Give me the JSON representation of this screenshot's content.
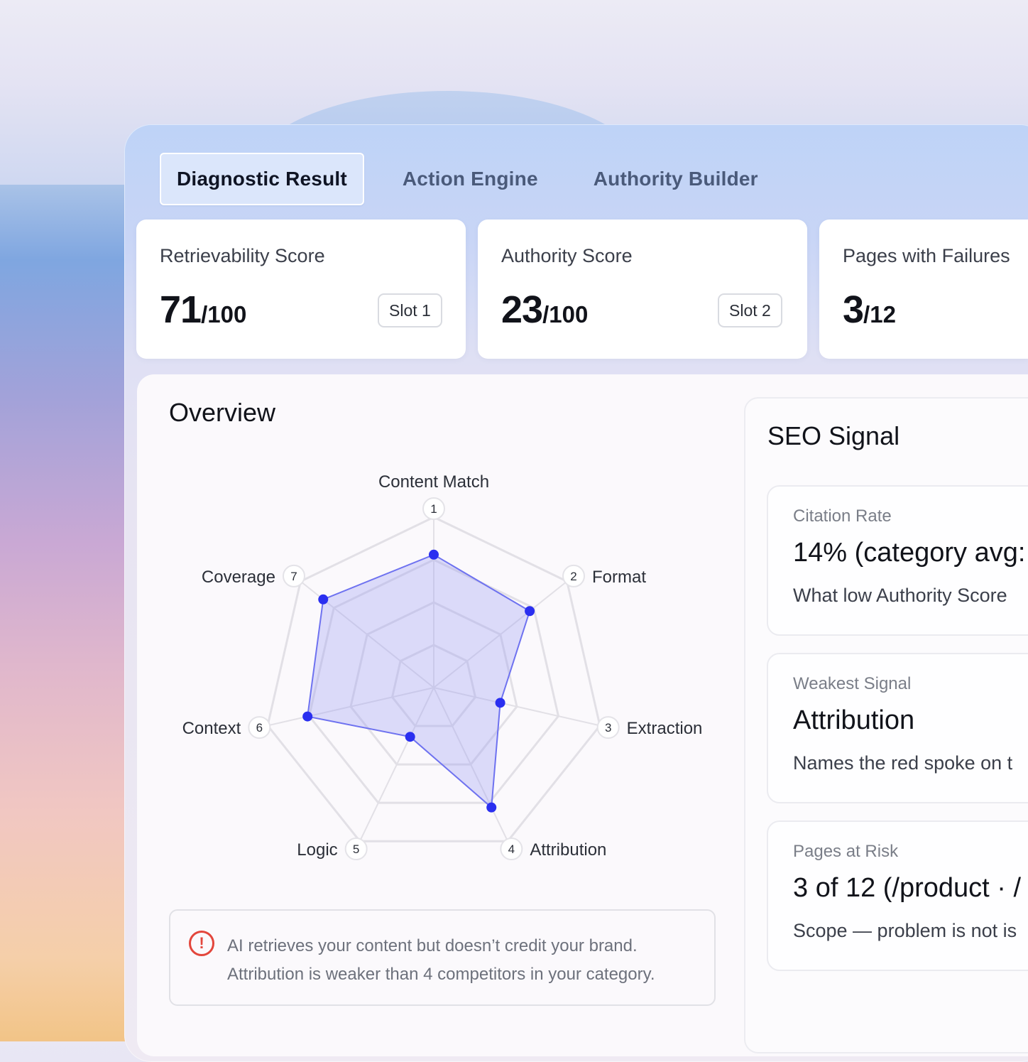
{
  "tabs": [
    {
      "label": "Diagnostic Result",
      "active": true
    },
    {
      "label": "Action Engine",
      "active": false
    },
    {
      "label": "Authority Builder",
      "active": false
    }
  ],
  "cards": [
    {
      "label": "Retrievability Score",
      "value": "71",
      "denominator": "/100",
      "slot": "Slot 1"
    },
    {
      "label": "Authority Score",
      "value": "23",
      "denominator": "/100",
      "slot": "Slot 2"
    },
    {
      "label": "Pages with Failures",
      "value": "3",
      "denominator": "/12"
    }
  ],
  "overview": {
    "title": "Overview",
    "alert": {
      "icon": "alert-circle-icon",
      "line1": "AI retrieves your content but doesn’t credit your brand.",
      "line2": "Attribution is weaker than 4 competitors in your category."
    }
  },
  "chart_data": {
    "type": "radar",
    "axes": [
      {
        "index": "1",
        "name": "Content Match"
      },
      {
        "index": "2",
        "name": "Format"
      },
      {
        "index": "3",
        "name": "Extraction"
      },
      {
        "index": "4",
        "name": "Attribution"
      },
      {
        "index": "5",
        "name": "Logic"
      },
      {
        "index": "6",
        "name": "Context"
      },
      {
        "index": "7",
        "name": "Coverage"
      }
    ],
    "values": [
      0.78,
      0.72,
      0.4,
      0.78,
      0.32,
      0.76,
      0.83
    ],
    "max": 1,
    "rings": 4,
    "colors": {
      "fill": "#9a9cf2",
      "stroke": "#6e72f0",
      "point": "#2a2ff0",
      "grid": "#e2e0e6"
    }
  },
  "seo": {
    "title": "SEO Signal",
    "signals": [
      {
        "label": "Citation Rate",
        "value": "14% (category avg:",
        "desc": "What low Authority Score"
      },
      {
        "label": "Weakest Signal",
        "value": "Attribution",
        "desc": "Names the red spoke on t"
      },
      {
        "label": "Pages at Risk",
        "value": "3 of 12 (/product · /",
        "desc": "Scope — problem is not is"
      }
    ]
  },
  "colors": {
    "accent": "#2a2ff0",
    "alert": "#e3463c"
  }
}
